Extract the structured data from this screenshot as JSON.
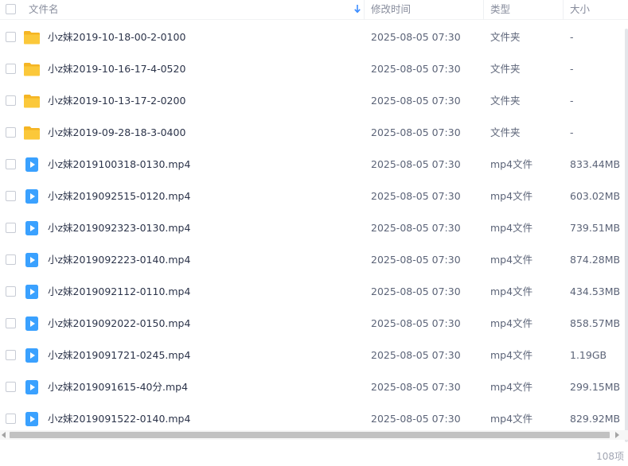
{
  "header": {
    "col_name": "文件名",
    "col_modified": "修改时间",
    "col_type": "类型",
    "col_size": "大小"
  },
  "rows": [
    {
      "icon": "folder-icon",
      "name": "小z妹2019-10-18-00-2-0100",
      "modified": "2025-08-05 07:30",
      "type": "文件夹",
      "size": "-"
    },
    {
      "icon": "folder-icon",
      "name": "小z妹2019-10-16-17-4-0520",
      "modified": "2025-08-05 07:30",
      "type": "文件夹",
      "size": "-"
    },
    {
      "icon": "folder-icon",
      "name": "小z妹2019-10-13-17-2-0200",
      "modified": "2025-08-05 07:30",
      "type": "文件夹",
      "size": "-"
    },
    {
      "icon": "folder-icon",
      "name": "小z妹2019-09-28-18-3-0400",
      "modified": "2025-08-05 07:30",
      "type": "文件夹",
      "size": "-"
    },
    {
      "icon": "video-file-icon",
      "name": "小z妹2019100318-0130.mp4",
      "modified": "2025-08-05 07:30",
      "type": "mp4文件",
      "size": "833.44MB"
    },
    {
      "icon": "video-file-icon",
      "name": "小z妹2019092515-0120.mp4",
      "modified": "2025-08-05 07:30",
      "type": "mp4文件",
      "size": "603.02MB"
    },
    {
      "icon": "video-file-icon",
      "name": "小z妹2019092323-0130.mp4",
      "modified": "2025-08-05 07:30",
      "type": "mp4文件",
      "size": "739.51MB"
    },
    {
      "icon": "video-file-icon",
      "name": "小z妹2019092223-0140.mp4",
      "modified": "2025-08-05 07:30",
      "type": "mp4文件",
      "size": "874.28MB"
    },
    {
      "icon": "video-file-icon",
      "name": "小z妹2019092112-0110.mp4",
      "modified": "2025-08-05 07:30",
      "type": "mp4文件",
      "size": "434.53MB"
    },
    {
      "icon": "video-file-icon",
      "name": "小z妹2019092022-0150.mp4",
      "modified": "2025-08-05 07:30",
      "type": "mp4文件",
      "size": "858.57MB"
    },
    {
      "icon": "video-file-icon",
      "name": "小z妹2019091721-0245.mp4",
      "modified": "2025-08-05 07:30",
      "type": "mp4文件",
      "size": "1.19GB"
    },
    {
      "icon": "video-file-icon",
      "name": "小z妹2019091615-40分.mp4",
      "modified": "2025-08-05 07:30",
      "type": "mp4文件",
      "size": "299.15MB"
    },
    {
      "icon": "video-file-icon",
      "name": "小z妹2019091522-0140.mp4",
      "modified": "2025-08-05 07:30",
      "type": "mp4文件",
      "size": "829.92MB"
    }
  ],
  "footer": {
    "item_count": "108项"
  },
  "colors": {
    "folder": "#fbc83a",
    "video": "#3aa1ff",
    "sort_arrow": "#3b8cff"
  }
}
